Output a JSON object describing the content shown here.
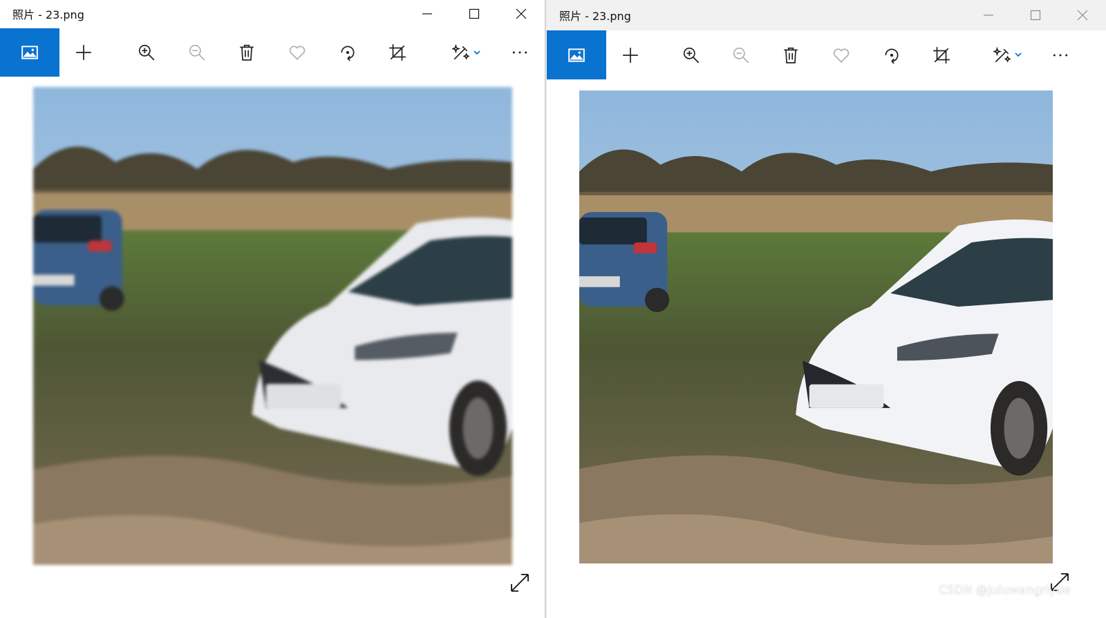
{
  "windows": [
    {
      "title": "照片 - 23.png",
      "toolbar": {
        "items": [
          {
            "name": "view-photo",
            "icon": "photo-icon",
            "active": true
          },
          {
            "name": "add",
            "icon": "plus-icon"
          },
          {
            "name": "zoom-in",
            "icon": "zoom-in-icon"
          },
          {
            "name": "zoom-out",
            "icon": "zoom-out-icon"
          },
          {
            "name": "delete",
            "icon": "trash-icon"
          },
          {
            "name": "favorite",
            "icon": "heart-icon"
          },
          {
            "name": "rotate",
            "icon": "rotate-icon"
          },
          {
            "name": "crop",
            "icon": "crop-icon"
          },
          {
            "name": "edit",
            "icon": "edit-wand-icon"
          },
          {
            "name": "more",
            "icon": "more-icon"
          }
        ]
      }
    },
    {
      "title": "照片 - 23.png",
      "toolbar": {
        "items": [
          {
            "name": "view-photo",
            "icon": "photo-icon",
            "active": true
          },
          {
            "name": "add",
            "icon": "plus-icon"
          },
          {
            "name": "zoom-in",
            "icon": "zoom-in-icon"
          },
          {
            "name": "zoom-out",
            "icon": "zoom-out-icon"
          },
          {
            "name": "delete",
            "icon": "trash-icon"
          },
          {
            "name": "favorite",
            "icon": "heart-icon"
          },
          {
            "name": "rotate",
            "icon": "rotate-icon"
          },
          {
            "name": "crop",
            "icon": "crop-icon"
          },
          {
            "name": "edit",
            "icon": "edit-wand-icon"
          },
          {
            "name": "more",
            "icon": "more-icon"
          }
        ]
      }
    }
  ],
  "watermark": "CSDN @juluwangriyue",
  "colors": {
    "accent": "#0a73d0"
  }
}
